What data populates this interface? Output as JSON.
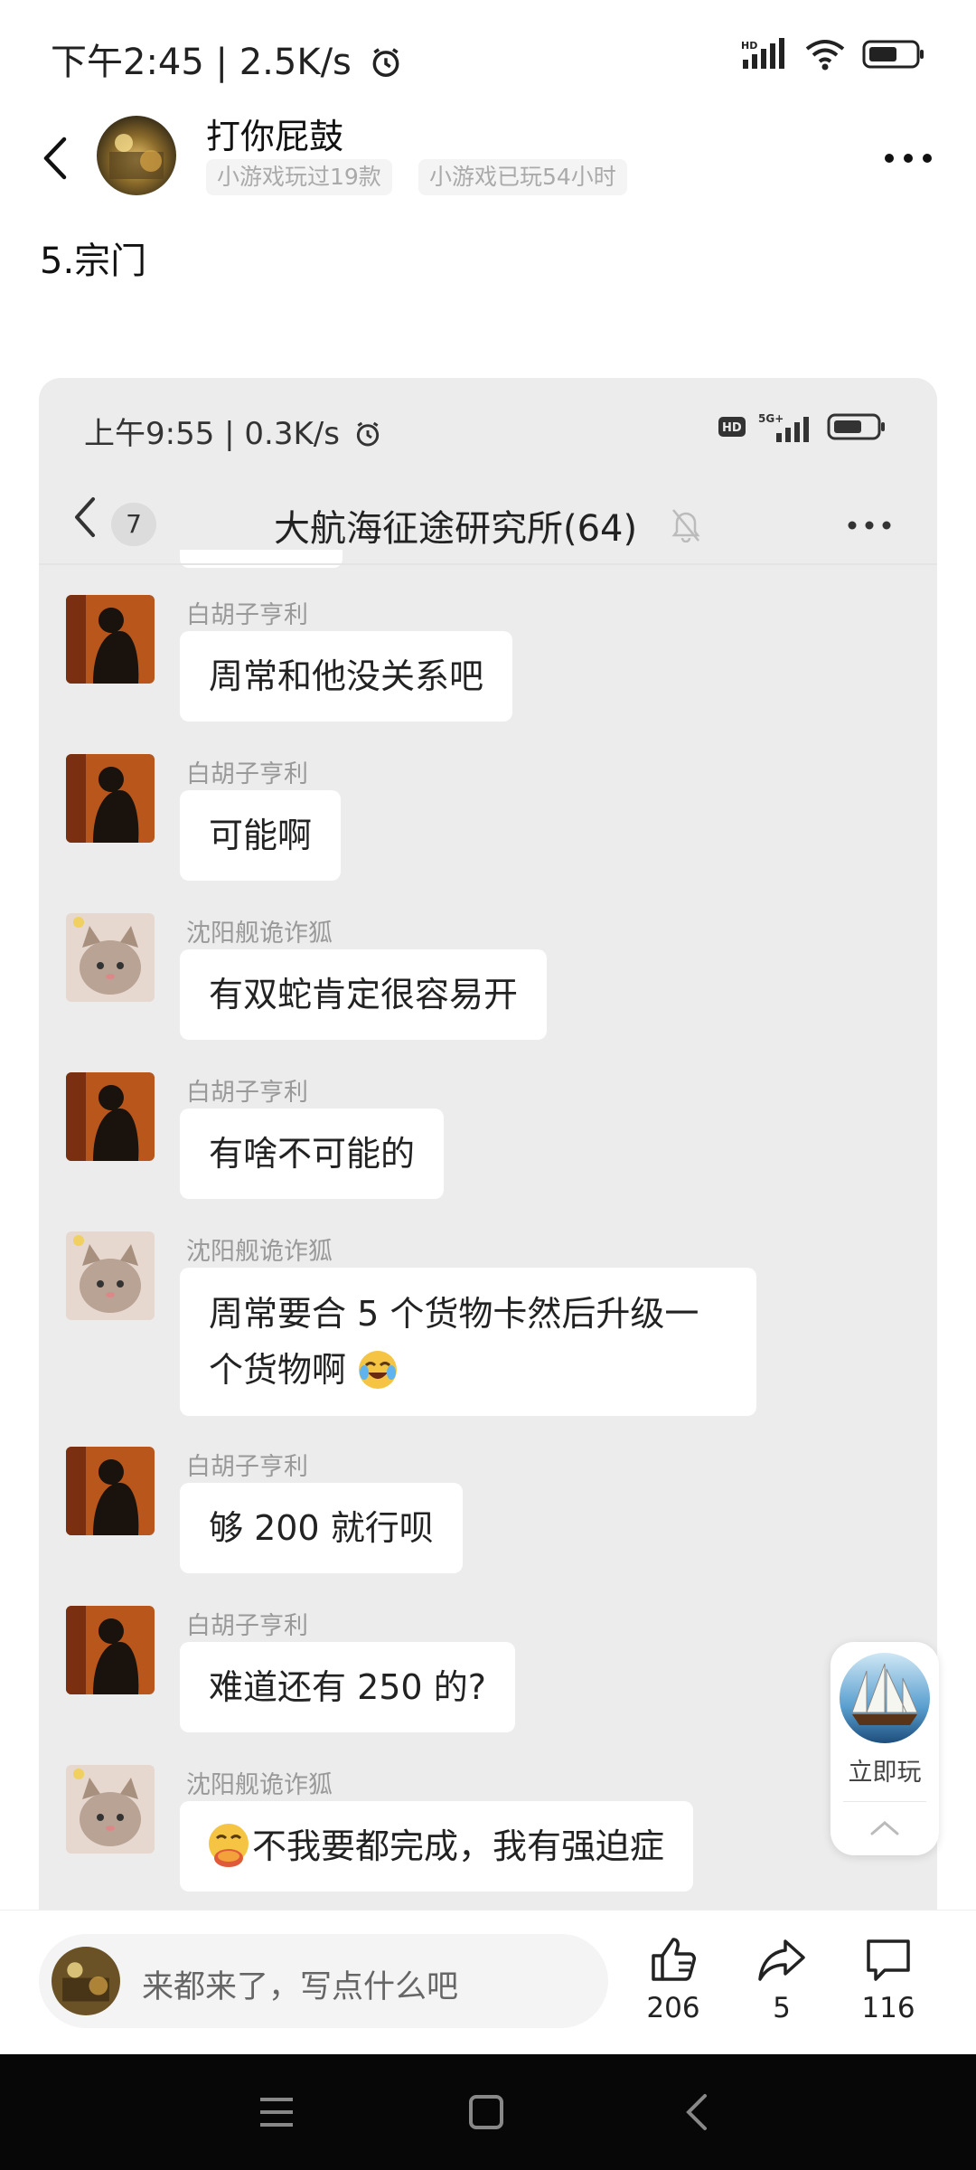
{
  "status_bar": {
    "time": "下午2:45 | 2.5K/s",
    "icons": [
      "alarm-icon",
      "hd-icon",
      "signal-icon",
      "wifi-icon",
      "battery-icon"
    ]
  },
  "header": {
    "author_name": "打你屁鼓",
    "tags": [
      "小游戏玩过19款",
      "小游戏已玩54小时"
    ],
    "icons": [
      "back-arrow-icon",
      "more-icon"
    ]
  },
  "post": {
    "title": "5.宗门"
  },
  "screenshot": {
    "status_time": "上午9:55 | 0.3K/s",
    "unread_count": "7",
    "chat_title": "大航海征途研究所(64)",
    "messages": [
      {
        "sender": "白胡子亨利",
        "text": "周常和他没关系吧"
      },
      {
        "sender": "白胡子亨利",
        "text": "可能啊"
      },
      {
        "sender": "沈阳舰诡诈狐",
        "text": "有双蛇肯定很容易开"
      },
      {
        "sender": "白胡子亨利",
        "text": "有啥不可能的"
      },
      {
        "sender": "沈阳舰诡诈狐",
        "text": "周常要合 5 个货物卡然后升级一个货物啊",
        "emoji": "laughing-crying-emoji"
      },
      {
        "sender": "白胡子亨利",
        "text": "够 200 就行呗"
      },
      {
        "sender": "白胡子亨利",
        "text": "难道还有 250 的?"
      },
      {
        "sender": "沈阳舰诡诈狐",
        "text": "不我要都完成，我有强迫症",
        "emoji": "hand-over-mouth-emoji"
      }
    ]
  },
  "play_card": {
    "label": "立即玩"
  },
  "bottom_bar": {
    "comment_placeholder": "来都来了，写点什么吧",
    "likes": "206",
    "shares": "5",
    "comments": "116"
  },
  "colors": {
    "chat_bg": "#ececec",
    "bubble": "#ffffff",
    "nav_bar": "#070707"
  }
}
